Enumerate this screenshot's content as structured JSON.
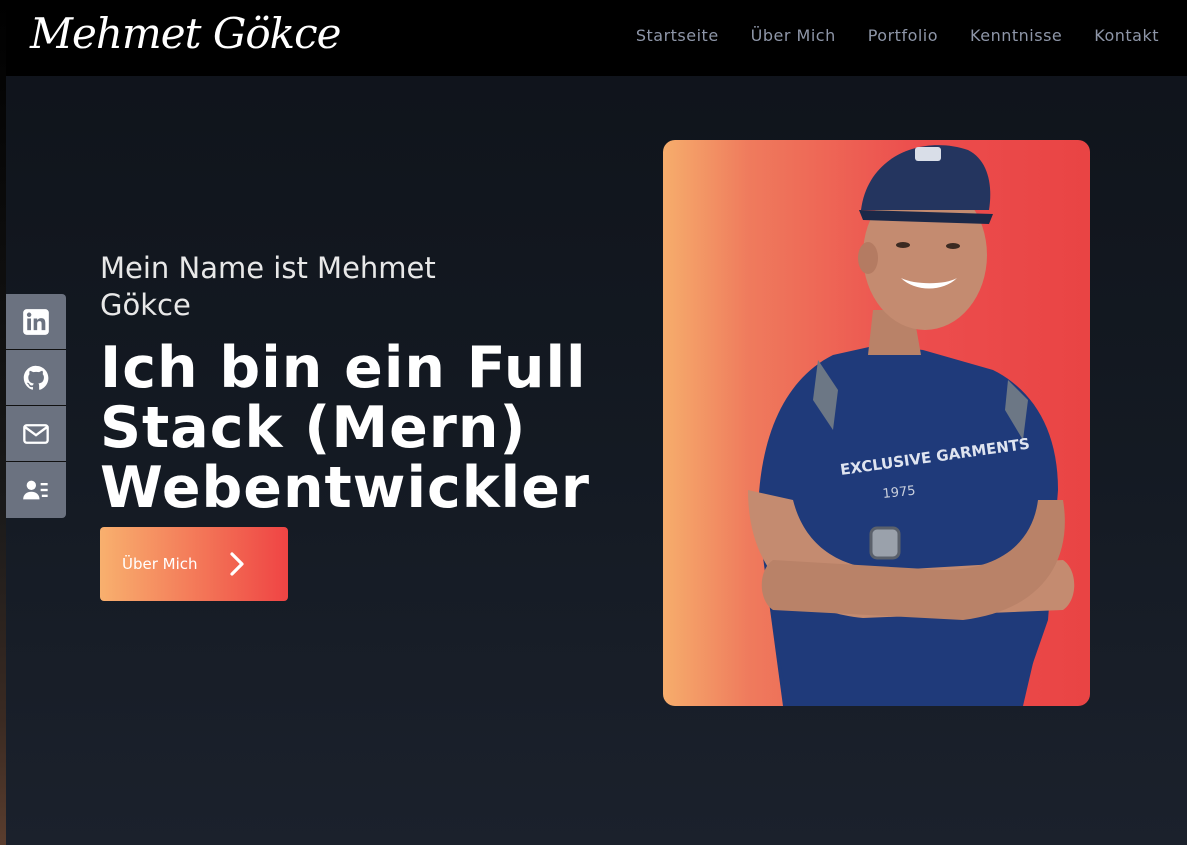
{
  "brand": {
    "logo": "Mehmet Gökce"
  },
  "nav": {
    "items": [
      {
        "label": "Startseite"
      },
      {
        "label": "Über Mich"
      },
      {
        "label": "Portfolio"
      },
      {
        "label": "Kenntnisse"
      },
      {
        "label": "Kontakt"
      }
    ]
  },
  "social": {
    "items": [
      {
        "icon": "linkedin-icon"
      },
      {
        "icon": "github-icon"
      },
      {
        "icon": "mail-icon"
      },
      {
        "icon": "contact-card-icon"
      }
    ]
  },
  "hero": {
    "intro": "Mein Name ist Mehmet Gökce",
    "headline": "Ich bin ein Full Stack (Mern) Webentwickler",
    "cta_label": "Über Mich"
  },
  "colors": {
    "accent_start": "#f8b06e",
    "accent_end": "#ef4444",
    "nav_text": "#8e96a8",
    "sidebar_bg": "#6b7280"
  }
}
